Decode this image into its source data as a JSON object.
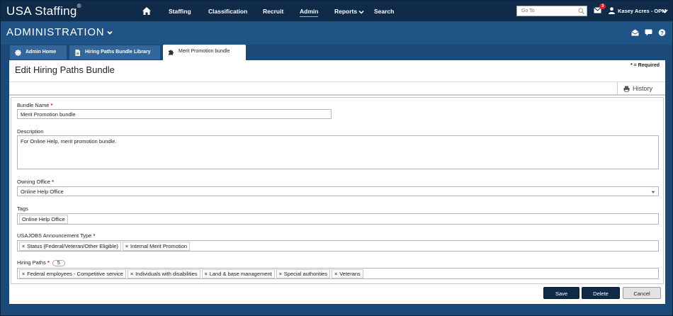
{
  "topnav": {
    "brand": "USA Staffing",
    "brand_mark": "®",
    "items": [
      {
        "label": "Staffing"
      },
      {
        "label": "Classification"
      },
      {
        "label": "Recruit"
      },
      {
        "label": "Admin"
      },
      {
        "label": "Reports"
      },
      {
        "label": "Search"
      }
    ],
    "goto_placeholder": "Go To",
    "mail_count": "3",
    "user_name": "Kasey Acres - OPM"
  },
  "admin_header": {
    "title": "ADMINISTRATION"
  },
  "tabs": [
    {
      "label": "Admin Home",
      "icon": "gear-icon"
    },
    {
      "label": "Hiring Paths Bundle Library",
      "icon": "document-icon"
    },
    {
      "label": "Merit Promotion bundle",
      "icon": "puzzle-icon"
    }
  ],
  "page": {
    "title": "Edit Hiring Paths Bundle",
    "required_note": "* = Required",
    "history_label": "History"
  },
  "form": {
    "bundle_name": {
      "label": "Bundle Name",
      "required": "*",
      "value": "Merit Promotion bundle"
    },
    "description": {
      "label": "Description",
      "value": "For Online Help, merit promotion bundle."
    },
    "owning_office": {
      "label": "Owning Office",
      "required": "*",
      "value": "Online Help Office"
    },
    "tags": {
      "label": "Tags",
      "chips": [
        "Online Help Office"
      ]
    },
    "announcement_type": {
      "label": "USAJOBS Announcement Type",
      "required": "*",
      "chips": [
        "Status (Federal/Veteran/Other Eligible)",
        "Internal Merit Promotion"
      ]
    },
    "hiring_paths": {
      "label": "Hiring Paths",
      "required": "*",
      "count": "5",
      "chips": [
        "Federal employees - Competitive service",
        "Individuals with disabilities",
        "Land & base management",
        "Special authorities",
        "Veterans"
      ]
    }
  },
  "actions": {
    "save": "Save",
    "delete": "Delete",
    "cancel": "Cancel"
  },
  "colors": {
    "nav_bg": "#102a4a",
    "admin_bg": "#1f5285",
    "tab_bg": "#35669a",
    "badge": "#d21f2b",
    "required": "#c41a1a"
  }
}
